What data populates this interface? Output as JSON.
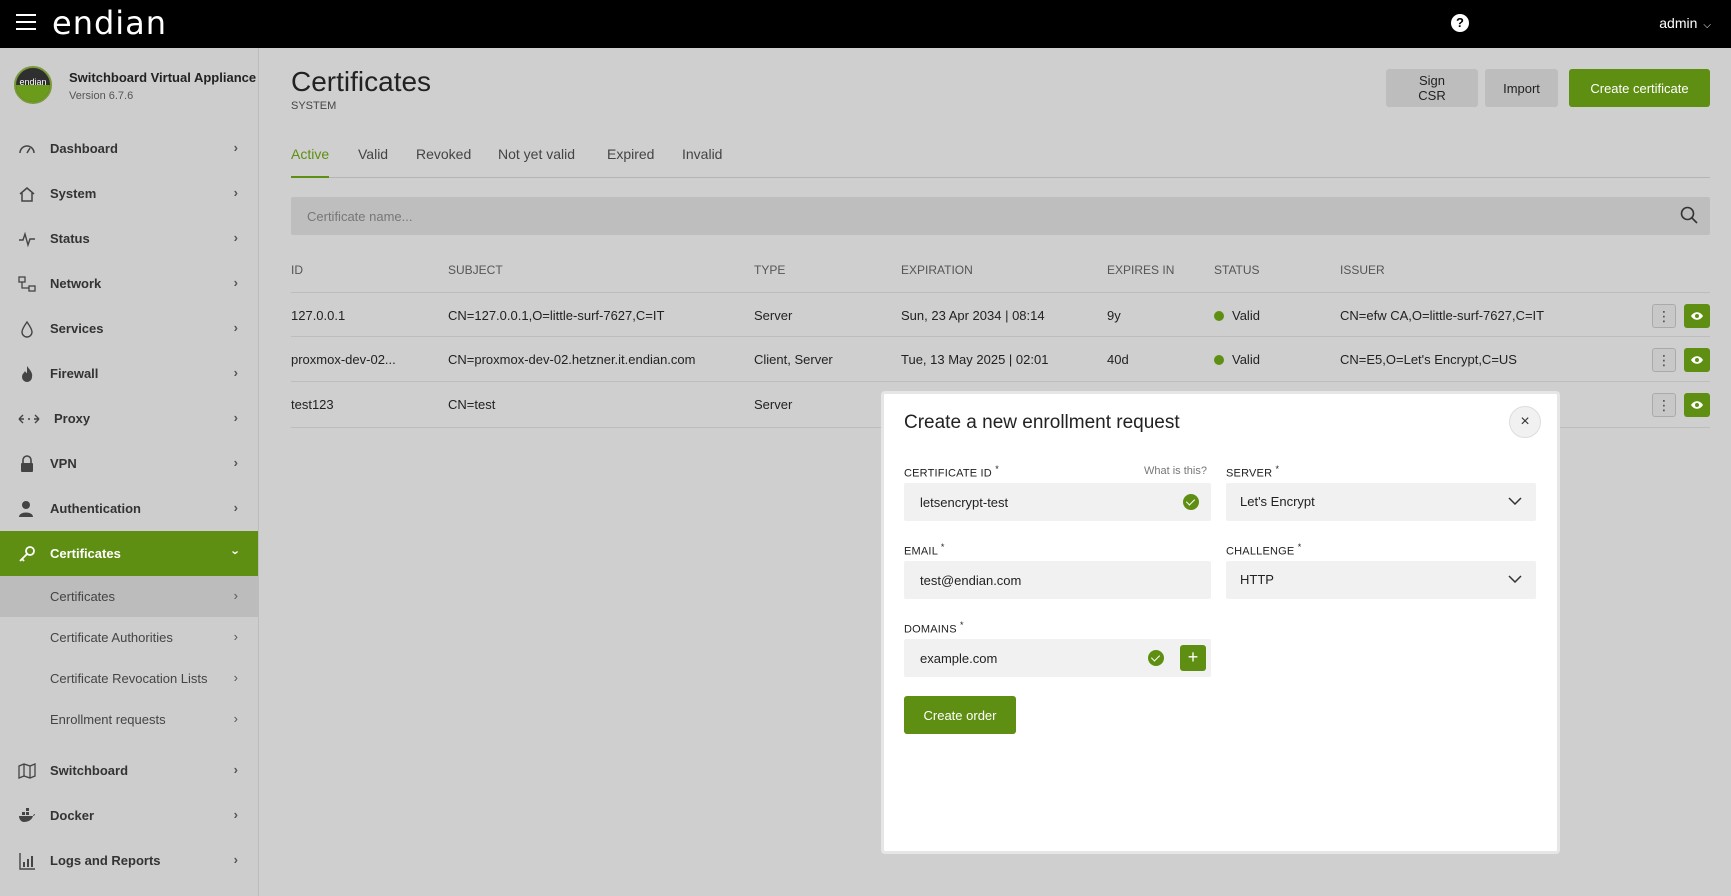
{
  "topbar": {
    "logo": "endian",
    "help_glyph": "?",
    "user": "admin"
  },
  "brand": {
    "avatar_text": "endian",
    "name": "Switchboard Virtual Appliance",
    "version": "Version 6.7.6"
  },
  "sidebar": {
    "items": [
      {
        "label": "Dashboard",
        "icon": "gauge-icon"
      },
      {
        "label": "System",
        "icon": "home-icon"
      },
      {
        "label": "Status",
        "icon": "pulse-icon"
      },
      {
        "label": "Network",
        "icon": "network-icon"
      },
      {
        "label": "Services",
        "icon": "drop-icon"
      },
      {
        "label": "Firewall",
        "icon": "flame-icon"
      },
      {
        "label": "Proxy",
        "icon": "proxy-icon"
      },
      {
        "label": "VPN",
        "icon": "lock-icon"
      },
      {
        "label": "Authentication",
        "icon": "user-icon"
      },
      {
        "label": "Certificates",
        "icon": "key-icon",
        "active": true
      }
    ],
    "subitems": [
      {
        "label": "Certificates",
        "current": true
      },
      {
        "label": "Certificate Authorities"
      },
      {
        "label": "Certificate Revocation Lists"
      },
      {
        "label": "Enrollment requests"
      }
    ],
    "bottom_items": [
      {
        "label": "Switchboard",
        "icon": "map-icon"
      },
      {
        "label": "Docker",
        "icon": "docker-icon"
      },
      {
        "label": "Logs and Reports",
        "icon": "chart-icon"
      }
    ]
  },
  "page": {
    "title": "Certificates",
    "subtitle": "SYSTEM",
    "buttons": {
      "sign_csr": "Sign CSR",
      "import": "Import",
      "create": "Create certificate"
    },
    "tabs": [
      "Active",
      "Valid",
      "Revoked",
      "Not yet valid",
      "Expired",
      "Invalid"
    ],
    "search_placeholder": "Certificate name..."
  },
  "table": {
    "headers": [
      "ID",
      "SUBJECT",
      "TYPE",
      "EXPIRATION",
      "EXPIRES IN",
      "STATUS",
      "ISSUER"
    ],
    "rows": [
      {
        "id": "127.0.0.1",
        "subject": "CN=127.0.0.1,O=little-surf-7627,C=IT",
        "type": "Server",
        "expiration": "Sun, 23 Apr 2034 | 08:14",
        "expires_in": "9y",
        "status": "Valid",
        "issuer": "CN=efw CA,O=little-surf-7627,C=IT"
      },
      {
        "id": "proxmox-dev-02...",
        "subject": "CN=proxmox-dev-02.hetzner.it.endian.com",
        "type": "Client, Server",
        "expiration": "Tue, 13 May 2025 | 02:01",
        "expires_in": "40d",
        "status": "Valid",
        "issuer": "CN=E5,O=Let's Encrypt,C=US"
      },
      {
        "id": "test123",
        "subject": "CN=test",
        "type": "Server",
        "expiration": "",
        "expires_in": "",
        "status": "",
        "issuer": ""
      }
    ],
    "kebab_glyph": "⋮"
  },
  "modal": {
    "title": "Create a new enrollment request",
    "close_glyph": "×",
    "certificate_id": {
      "label": "CERTIFICATE ID",
      "value": "letsencrypt-test",
      "help": "What is this?"
    },
    "server": {
      "label": "SERVER",
      "value": "Let's Encrypt"
    },
    "email": {
      "label": "EMAIL",
      "value": "test@endian.com"
    },
    "challenge": {
      "label": "CHALLENGE",
      "value": "HTTP"
    },
    "domains": {
      "label": "DOMAINS",
      "value": "example.com",
      "add_glyph": "+"
    },
    "required_mark": "*",
    "submit": "Create order"
  },
  "colors": {
    "accent": "#5f8f12",
    "topbar": "#000000",
    "sidebar": "#cdcdcd"
  }
}
